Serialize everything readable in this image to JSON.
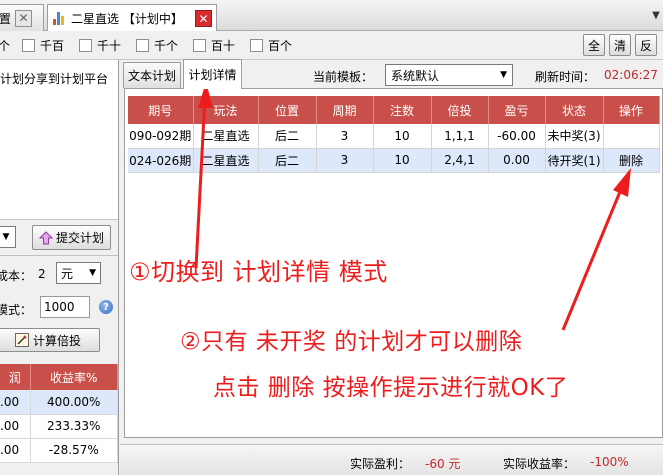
{
  "tabstrip": {
    "prev_tab_label": "置",
    "active_tab_label": "二星直选 【计划中】"
  },
  "checkbox_row": {
    "items": [
      "个",
      "千百",
      "千十",
      "千个",
      "百十",
      "百个"
    ],
    "buttons": [
      "全",
      "清",
      "反"
    ]
  },
  "left_panel": {
    "share_text": "计划分享到计划平台",
    "submit_button": "提交计划",
    "cost_label": "成本：",
    "cost_value": "2",
    "cost_unit": "元",
    "mode_label": "模式：",
    "mode_value": "1000",
    "calc_button": "计算倍投",
    "table": {
      "headers": [
        "润",
        "收益率%"
      ],
      "rows": [
        [
          ".00",
          "400.00%"
        ],
        [
          ".00",
          "233.33%"
        ],
        [
          ".00",
          "-28.57%"
        ]
      ]
    }
  },
  "right_panel": {
    "tabs": [
      "文本计划",
      "计划详情"
    ],
    "template_label": "当前模板：",
    "template_value": "系统默认",
    "refresh_label": "刷新时间：",
    "refresh_time": "02:06:27",
    "plans_table": {
      "headers": [
        "期号",
        "玩法",
        "位置",
        "周期",
        "注数",
        "倍投",
        "盈亏",
        "状态",
        "操作"
      ],
      "rows": [
        [
          "090-092期",
          "二星直选",
          "后二",
          "3",
          "10",
          "1,1,1",
          "-60.00",
          "未中奖(3)",
          ""
        ],
        [
          "024-026期",
          "二星直选",
          "后二",
          "3",
          "10",
          "2,4,1",
          "0.00",
          "待开奖(1)",
          "删除"
        ]
      ]
    },
    "summary": {
      "profit_label": "实际盈利：",
      "profit_value": "-60 元",
      "rate_label": "实际收益率：",
      "rate_value": "-100%"
    }
  },
  "annotations": {
    "step1": "①切换到 计划详情 模式",
    "step2": "②只有 未开奖 的计划才可以删除",
    "step3": "点击  删除 按操作提示进行就OK了"
  },
  "colors": {
    "header_red": "#c9504a",
    "annotation_red": "#ee1d1d",
    "value_red": "#c0282a",
    "selected_row": "#dde8fb"
  }
}
